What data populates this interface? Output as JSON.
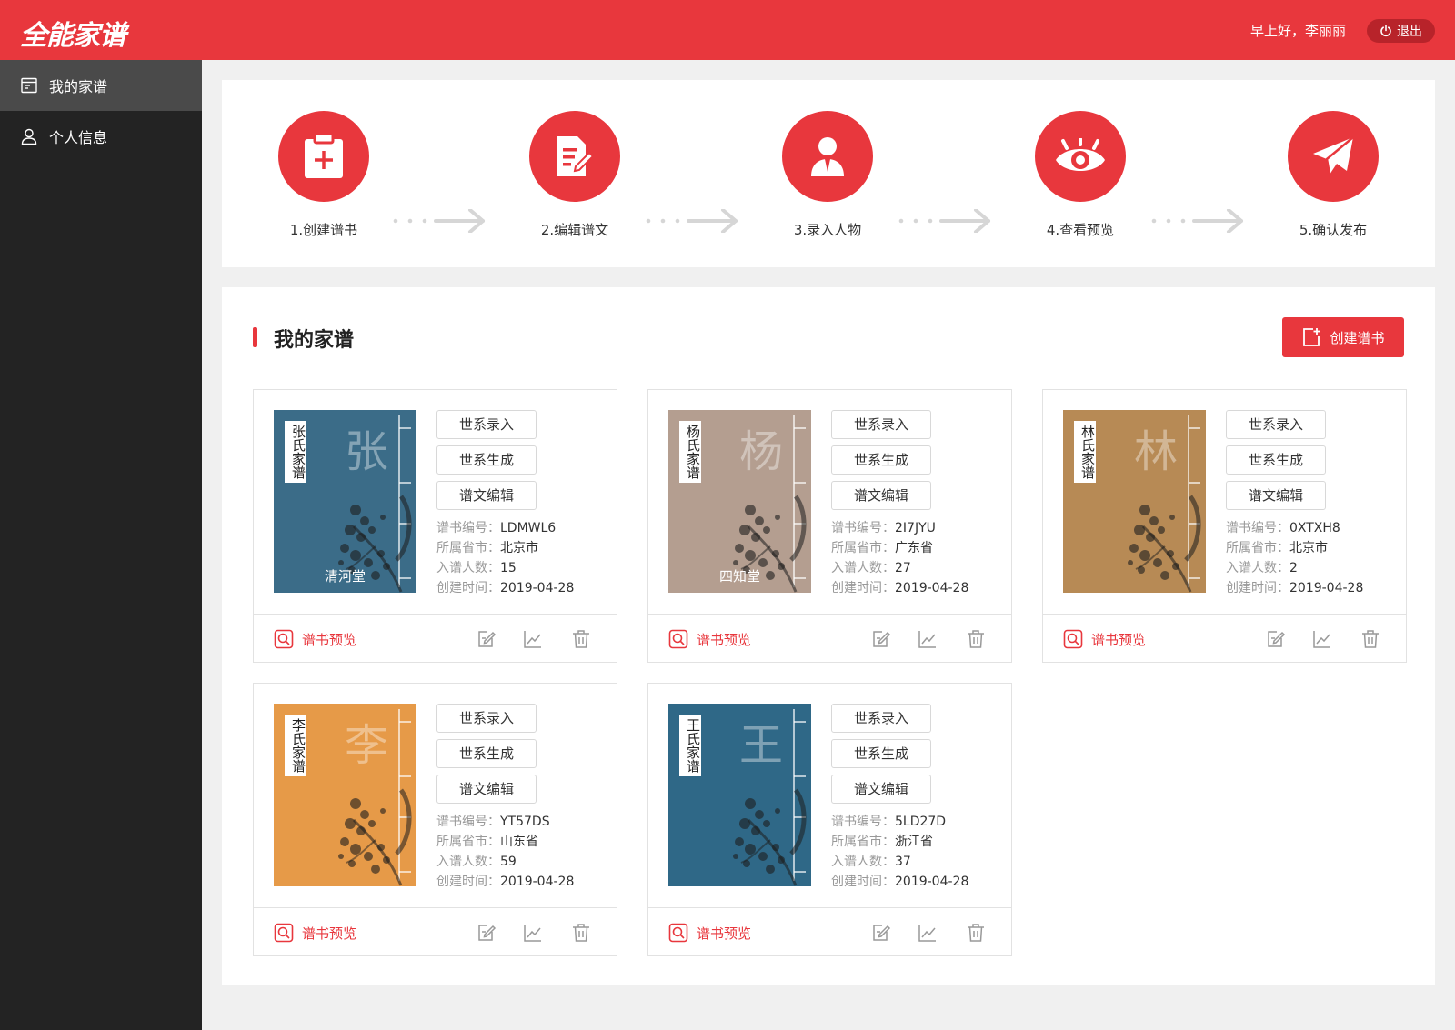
{
  "header": {
    "logo": "全能家谱",
    "greeting": "早上好，李丽丽",
    "logout_label": "退出"
  },
  "sidebar": {
    "items": [
      {
        "label": "我的家谱",
        "icon": "book-icon"
      },
      {
        "label": "个人信息",
        "icon": "user-icon"
      }
    ]
  },
  "steps": [
    {
      "label": "1.创建谱书",
      "icon": "add-book-icon"
    },
    {
      "label": "2.编辑谱文",
      "icon": "edit-document-icon"
    },
    {
      "label": "3.录入人物",
      "icon": "person-icon"
    },
    {
      "label": "4.查看预览",
      "icon": "eye-icon"
    },
    {
      "label": "5.确认发布",
      "icon": "paper-plane-icon"
    }
  ],
  "main": {
    "title": "我的家谱",
    "create_label": "创建谱书"
  },
  "card_actions": {
    "entry": "世系录入",
    "generate": "世系生成",
    "edit": "谱文编辑",
    "preview": "谱书预览"
  },
  "field_labels": {
    "code": "谱书编号：",
    "province": "所属省市：",
    "count": "入谱人数：",
    "created": "创建时间："
  },
  "books": [
    {
      "tag": "张氏家谱",
      "big": "张",
      "hall": "清河堂",
      "code": "LDMWL6",
      "province": "北京市",
      "count": "15",
      "created": "2019-04-28",
      "color": "#3b6c88"
    },
    {
      "tag": "杨氏家谱",
      "big": "杨",
      "hall": "四知堂",
      "code": "2I7JYU",
      "province": "广东省",
      "count": "27",
      "created": "2019-04-28",
      "color": "#b49e90"
    },
    {
      "tag": "林氏家谱",
      "big": "林",
      "hall": "",
      "code": "0XTXH8",
      "province": "北京市",
      "count": "2",
      "created": "2019-04-28",
      "color": "#b78a55"
    },
    {
      "tag": "李氏家谱",
      "big": "李",
      "hall": "",
      "code": "YT57DS",
      "province": "山东省",
      "count": "59",
      "created": "2019-04-28",
      "color": "#e69a48"
    },
    {
      "tag": "王氏家谱",
      "big": "王",
      "hall": "",
      "code": "5LD27D",
      "province": "浙江省",
      "count": "37",
      "created": "2019-04-28",
      "color": "#2f6887"
    }
  ],
  "colors": {
    "brand": "#e8373d",
    "sidebar": "#232323"
  }
}
